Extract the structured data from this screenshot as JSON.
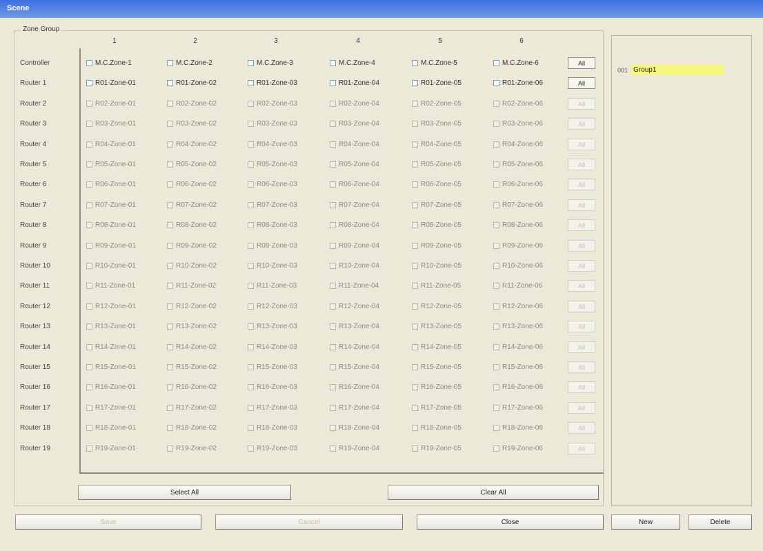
{
  "window": {
    "title": "Scene"
  },
  "zone_group": {
    "legend": "Zone Group",
    "column_headers": [
      "1",
      "2",
      "3",
      "4",
      "5",
      "6"
    ],
    "rows": [
      {
        "label": "Controller",
        "cells": [
          "M.C.Zone-1",
          "M.C.Zone-2",
          "M.C.Zone-3",
          "M.C.Zone-4",
          "M.C.Zone-5",
          "M.C.Zone-6"
        ],
        "enabled": true,
        "all_label": "All"
      },
      {
        "label": "Router 1",
        "cells": [
          "R01-Zone-01",
          "R01-Zone-02",
          "R01-Zone-03",
          "R01-Zone-04",
          "R01-Zone-05",
          "R01-Zone-06"
        ],
        "enabled": true,
        "all_label": "All"
      },
      {
        "label": "Router 2",
        "cells": [
          "R02-Zone-01",
          "R02-Zone-02",
          "R02-Zone-03",
          "R02-Zone-04",
          "R02-Zone-05",
          "R02-Zone-06"
        ],
        "enabled": false,
        "all_label": "All"
      },
      {
        "label": "Router 3",
        "cells": [
          "R03-Zone-01",
          "R03-Zone-02",
          "R03-Zone-03",
          "R03-Zone-04",
          "R03-Zone-05",
          "R03-Zone-06"
        ],
        "enabled": false,
        "all_label": "All"
      },
      {
        "label": "Router 4",
        "cells": [
          "R04-Zone-01",
          "R04-Zone-02",
          "R04-Zone-03",
          "R04-Zone-04",
          "R04-Zone-05",
          "R04-Zone-06"
        ],
        "enabled": false,
        "all_label": "All"
      },
      {
        "label": "Router 5",
        "cells": [
          "R05-Zone-01",
          "R05-Zone-02",
          "R05-Zone-03",
          "R05-Zone-04",
          "R05-Zone-05",
          "R05-Zone-06"
        ],
        "enabled": false,
        "all_label": "All"
      },
      {
        "label": "Router 6",
        "cells": [
          "R06-Zone-01",
          "R06-Zone-02",
          "R06-Zone-03",
          "R06-Zone-04",
          "R06-Zone-05",
          "R06-Zone-06"
        ],
        "enabled": false,
        "all_label": "All"
      },
      {
        "label": "Router 7",
        "cells": [
          "R07-Zone-01",
          "R07-Zone-02",
          "R07-Zone-03",
          "R07-Zone-04",
          "R07-Zone-05",
          "R07-Zone-06"
        ],
        "enabled": false,
        "all_label": "All"
      },
      {
        "label": "Router 8",
        "cells": [
          "R08-Zone-01",
          "R08-Zone-02",
          "R08-Zone-03",
          "R08-Zone-04",
          "R08-Zone-05",
          "R08-Zone-06"
        ],
        "enabled": false,
        "all_label": "All"
      },
      {
        "label": "Router 9",
        "cells": [
          "R09-Zone-01",
          "R09-Zone-02",
          "R09-Zone-03",
          "R09-Zone-04",
          "R09-Zone-05",
          "R09-Zone-06"
        ],
        "enabled": false,
        "all_label": "All"
      },
      {
        "label": "Router 10",
        "cells": [
          "R10-Zone-01",
          "R10-Zone-02",
          "R10-Zone-03",
          "R10-Zone-04",
          "R10-Zone-05",
          "R10-Zone-06"
        ],
        "enabled": false,
        "all_label": "All"
      },
      {
        "label": "Router 11",
        "cells": [
          "R11-Zone-01",
          "R11-Zone-02",
          "R11-Zone-03",
          "R11-Zone-04",
          "R11-Zone-05",
          "R11-Zone-06"
        ],
        "enabled": false,
        "all_label": "All"
      },
      {
        "label": "Router 12",
        "cells": [
          "R12-Zone-01",
          "R12-Zone-02",
          "R12-Zone-03",
          "R12-Zone-04",
          "R12-Zone-05",
          "R12-Zone-06"
        ],
        "enabled": false,
        "all_label": "All"
      },
      {
        "label": "Router 13",
        "cells": [
          "R13-Zone-01",
          "R13-Zone-02",
          "R13-Zone-03",
          "R13-Zone-04",
          "R13-Zone-05",
          "R13-Zone-06"
        ],
        "enabled": false,
        "all_label": "All"
      },
      {
        "label": "Router 14",
        "cells": [
          "R14-Zone-01",
          "R14-Zone-02",
          "R14-Zone-03",
          "R14-Zone-04",
          "R14-Zone-05",
          "R14-Zone-06"
        ],
        "enabled": false,
        "all_label": "All"
      },
      {
        "label": "Router 15",
        "cells": [
          "R15-Zone-01",
          "R15-Zone-02",
          "R15-Zone-03",
          "R15-Zone-04",
          "R15-Zone-05",
          "R15-Zone-06"
        ],
        "enabled": false,
        "all_label": "All"
      },
      {
        "label": "Router 16",
        "cells": [
          "R16-Zone-01",
          "R16-Zone-02",
          "R16-Zone-03",
          "R16-Zone-04",
          "R16-Zone-05",
          "R16-Zone-06"
        ],
        "enabled": false,
        "all_label": "All"
      },
      {
        "label": "Router 17",
        "cells": [
          "R17-Zone-01",
          "R17-Zone-02",
          "R17-Zone-03",
          "R17-Zone-04",
          "R17-Zone-05",
          "R17-Zone-06"
        ],
        "enabled": false,
        "all_label": "All"
      },
      {
        "label": "Router 18",
        "cells": [
          "R18-Zone-01",
          "R18-Zone-02",
          "R18-Zone-03",
          "R18-Zone-04",
          "R18-Zone-05",
          "R18-Zone-06"
        ],
        "enabled": false,
        "all_label": "All"
      },
      {
        "label": "Router 19",
        "cells": [
          "R19-Zone-01",
          "R19-Zone-02",
          "R19-Zone-03",
          "R19-Zone-04",
          "R19-Zone-05",
          "R19-Zone-06"
        ],
        "enabled": false,
        "all_label": "All"
      }
    ],
    "select_all_label": "Select All",
    "clear_all_label": "Clear All"
  },
  "footer": {
    "save_label": "Save",
    "cancel_label": "Cancel",
    "close_label": "Close",
    "new_label": "New",
    "delete_label": "Delete"
  },
  "group_list": {
    "items": [
      {
        "icon_text": "001",
        "label": "Group1"
      }
    ],
    "selected_color": "#f6f77d"
  }
}
